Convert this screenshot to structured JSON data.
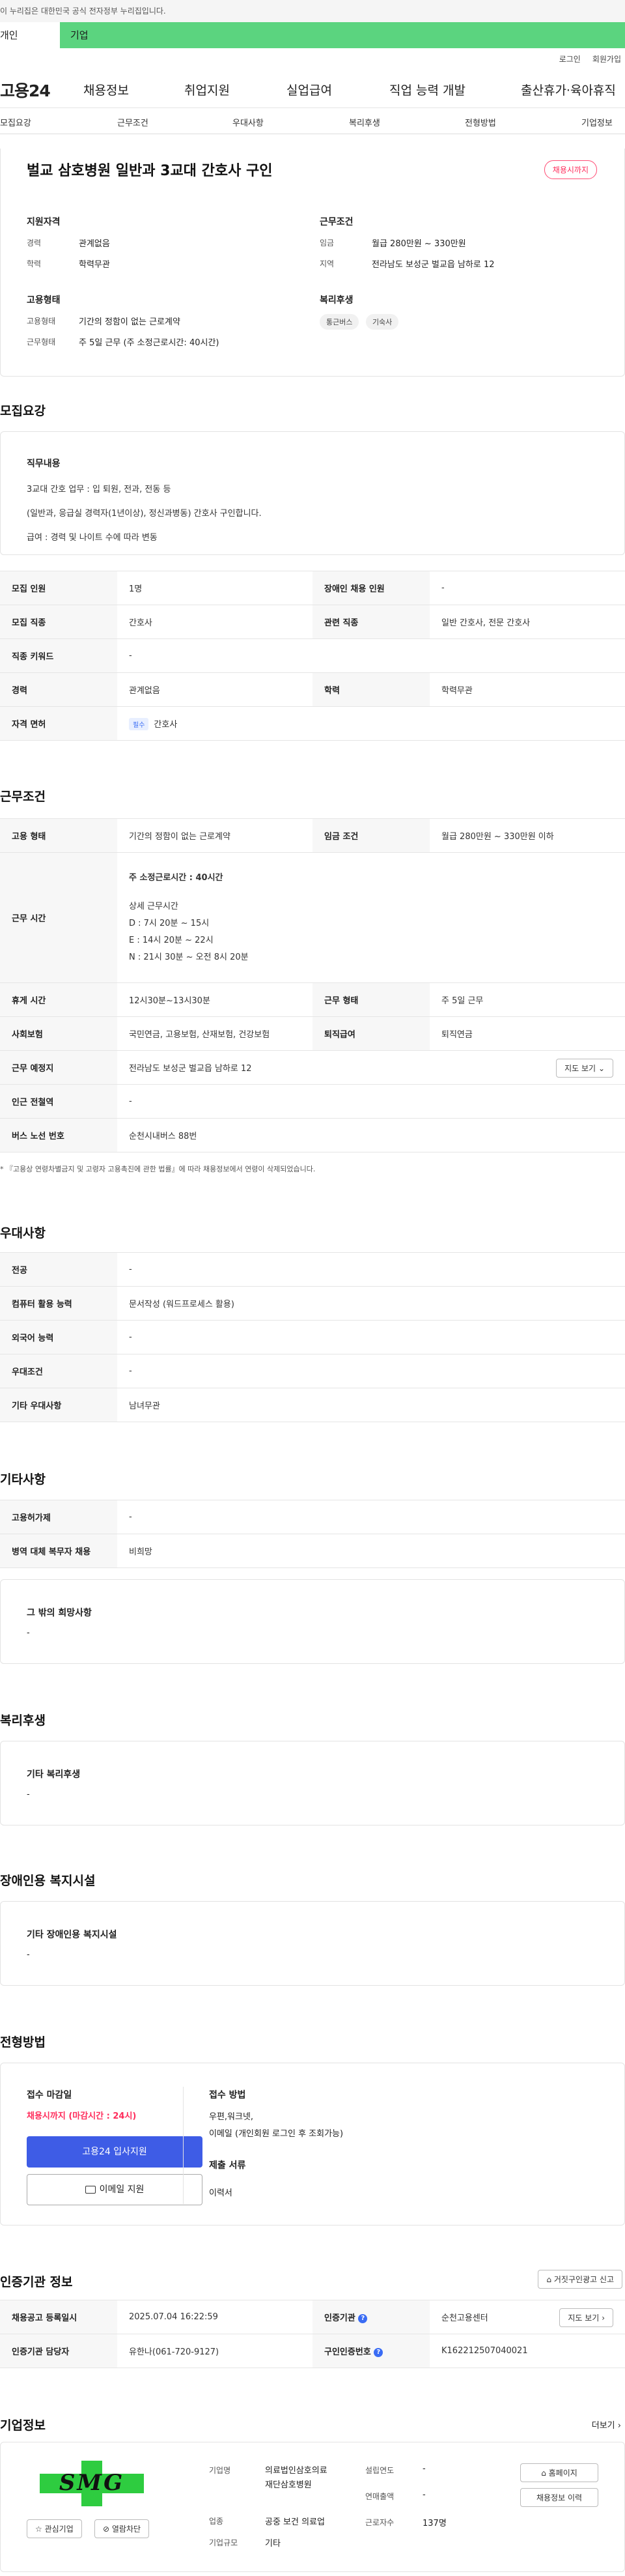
{
  "gov_banner": "이 누리집은 대한민국 공식 전자정부 누리집입니다.",
  "top_tabs": [
    "개인",
    "기업"
  ],
  "util_links": [
    "로그인",
    "회원가입"
  ],
  "gnb": {
    "logo": "고용24",
    "menus": [
      "채용정보",
      "취업지원",
      "실업급여",
      "직업 능력 개발",
      "출산휴가·육아휴직"
    ]
  },
  "anchors": [
    "모집요강",
    "근무조건",
    "우대사항",
    "복리후생",
    "전형방법",
    "기업정보"
  ],
  "job": {
    "title": "벌교 삼호병원 일반과 3교대 간호사 구인",
    "badge": "채용시까지",
    "qual_title": "지원자격",
    "career_label": "경력",
    "career": "관계없음",
    "edu_label": "학력",
    "edu": "학력무관",
    "cond_title": "근무조건",
    "wage_label": "임금",
    "wage": "월급 280만원 ~ 330만원",
    "region_label": "지역",
    "region": "전라남도 보성군 벌교읍 남하로 12",
    "emp_title": "고용형태",
    "emp_label": "고용형태",
    "emp": "기간의 정함이 없는 근로계약",
    "worktype_label": "근무형태",
    "worktype": "주 5일 근무 (주 소정근로시간: 40시간)",
    "welfare_title": "복리후생",
    "welfare_chips": [
      "통근버스",
      "기숙사"
    ]
  },
  "recruit": {
    "title": "모집요강",
    "duty_label": "직무내용",
    "duty_lines": [
      "3교대 간호 업무 : 입 퇴원, 전과, 전동 등",
      "(일반과, 응급실 경력자(1년이상), 정신과병동) 간호사 구인합니다.",
      "급여 : 경력 및 나이트 수에 따라 변동"
    ],
    "rows": [
      [
        "모집 인원",
        "1명",
        "장애인 채용 인원",
        "-"
      ],
      [
        "모집 직종",
        "간호사",
        "관련 직종",
        "일반 간호사, 전문 간호사"
      ],
      [
        "직종 키워드",
        "-"
      ],
      [
        "경력",
        "관계없음",
        "학력",
        "학력무관"
      ],
      [
        "자격 면허",
        "간호사"
      ]
    ],
    "license_tag": "필수"
  },
  "work": {
    "title": "근무조건",
    "emp_type_h": "고용 형태",
    "emp_type": "기간의 정함이 없는 근로계약",
    "wage_h": "임금 조건",
    "wage": "월급 280만원 ~ 330만원 이하",
    "hours_h": "근무 시간",
    "hours_week": "주 소정근로시간 : 40시간",
    "hours_detail_title": "상세 근무시간",
    "hours_detail": [
      "D : 7시 20분 ~ 15시",
      "E : 14시 20분 ~ 22시",
      "N : 21시 30분 ~ 오전 8시 20분"
    ],
    "break_h": "휴게 시간",
    "break": "12시30분~13시30분",
    "form_h": "근무 형태",
    "form": "주 5일 근무",
    "ins_h": "사회보험",
    "ins": "국민연금, 고용보험, 산재보험, 건강보험",
    "retire_h": "퇴직급여",
    "retire": "퇴직연금",
    "place_h": "근무 예정지",
    "place": "전라남도 보성군 벌교읍 남하로 12",
    "map_btn": "지도 보기",
    "station_h": "인근 전철역",
    "station": "-",
    "bus_h": "버스 노선 번호",
    "bus": "순천시내버스 88번",
    "note": "* 『고용상 연령차별금지 및 고령자 고용촉진에 관한 법률』에 따라 채용정보에서 연령이 삭제되었습니다."
  },
  "pref": {
    "title": "우대사항",
    "rows": [
      [
        "전공",
        "-"
      ],
      [
        "컴퓨터 활용 능력",
        "문서작성 (워드프로세스 활용)"
      ],
      [
        "외국어 능력",
        "-"
      ],
      [
        "우대조건",
        "-"
      ],
      [
        "기타 우대사항",
        "남녀무관"
      ]
    ]
  },
  "etc": {
    "title": "기타사항",
    "rows": [
      [
        "고용허가제",
        "-"
      ],
      [
        "병역 대체 복무자 채용",
        "비희망"
      ]
    ],
    "box_title": "그 밖의 희망사항",
    "box_value": "-"
  },
  "welfare": {
    "title": "복리후생",
    "label": "기타 복리후생",
    "value": "-"
  },
  "disabled": {
    "title": "장애인용 복지시설",
    "label": "기타 장애인용 복지시설",
    "value": "-"
  },
  "selection": {
    "title": "전형방법",
    "deadline_label": "접수 마감일",
    "deadline": "채용시까지 (마감시간 : 24시)",
    "apply_btn": "고용24 입사지원",
    "email_btn": "이메일 지원",
    "method_label": "접수 방법",
    "method_lines": [
      "우편,워크넷,",
      "이메일 (개인회원 로그인 후 조회가능)"
    ],
    "docs_label": "제출 서류",
    "docs": "이력서"
  },
  "agency": {
    "title": "인증기관 정보",
    "report_btn": "거짓구인광고 신고",
    "reg_h": "채용공고 등록일시",
    "reg": "2025.07.04 16:22:59",
    "org_h": "인증기관",
    "org": "순천고용센터",
    "map_btn": "지도 보기",
    "mgr_h": "인증기관 담당자",
    "mgr": "유한나(061-720-9127)",
    "id_h": "구인인증번호",
    "id": "K162212507040021"
  },
  "company": {
    "title": "기업정보",
    "more": "더보기",
    "logo_text": "SMG",
    "fav_btn": "관심기업",
    "block_btn": "열람차단",
    "name_label": "기업명",
    "name_lines": [
      "의료법인삼호의료",
      "재단삼호병원"
    ],
    "industry_label": "업종",
    "industry": "공중 보건 의료업",
    "size_label": "기업규모",
    "size": "기타",
    "year_label": "설립연도",
    "year": "-",
    "sales_label": "연매출액",
    "sales": "-",
    "emp_label": "근로자수",
    "emp": "137명",
    "home_btn": "홈페이지",
    "history_btn": "채용정보 이력"
  },
  "colors": {
    "green": "#5bd47f",
    "pink": "#ff2d5c",
    "blue": "#3a6cf4",
    "logo_green": "#2ecc40"
  }
}
